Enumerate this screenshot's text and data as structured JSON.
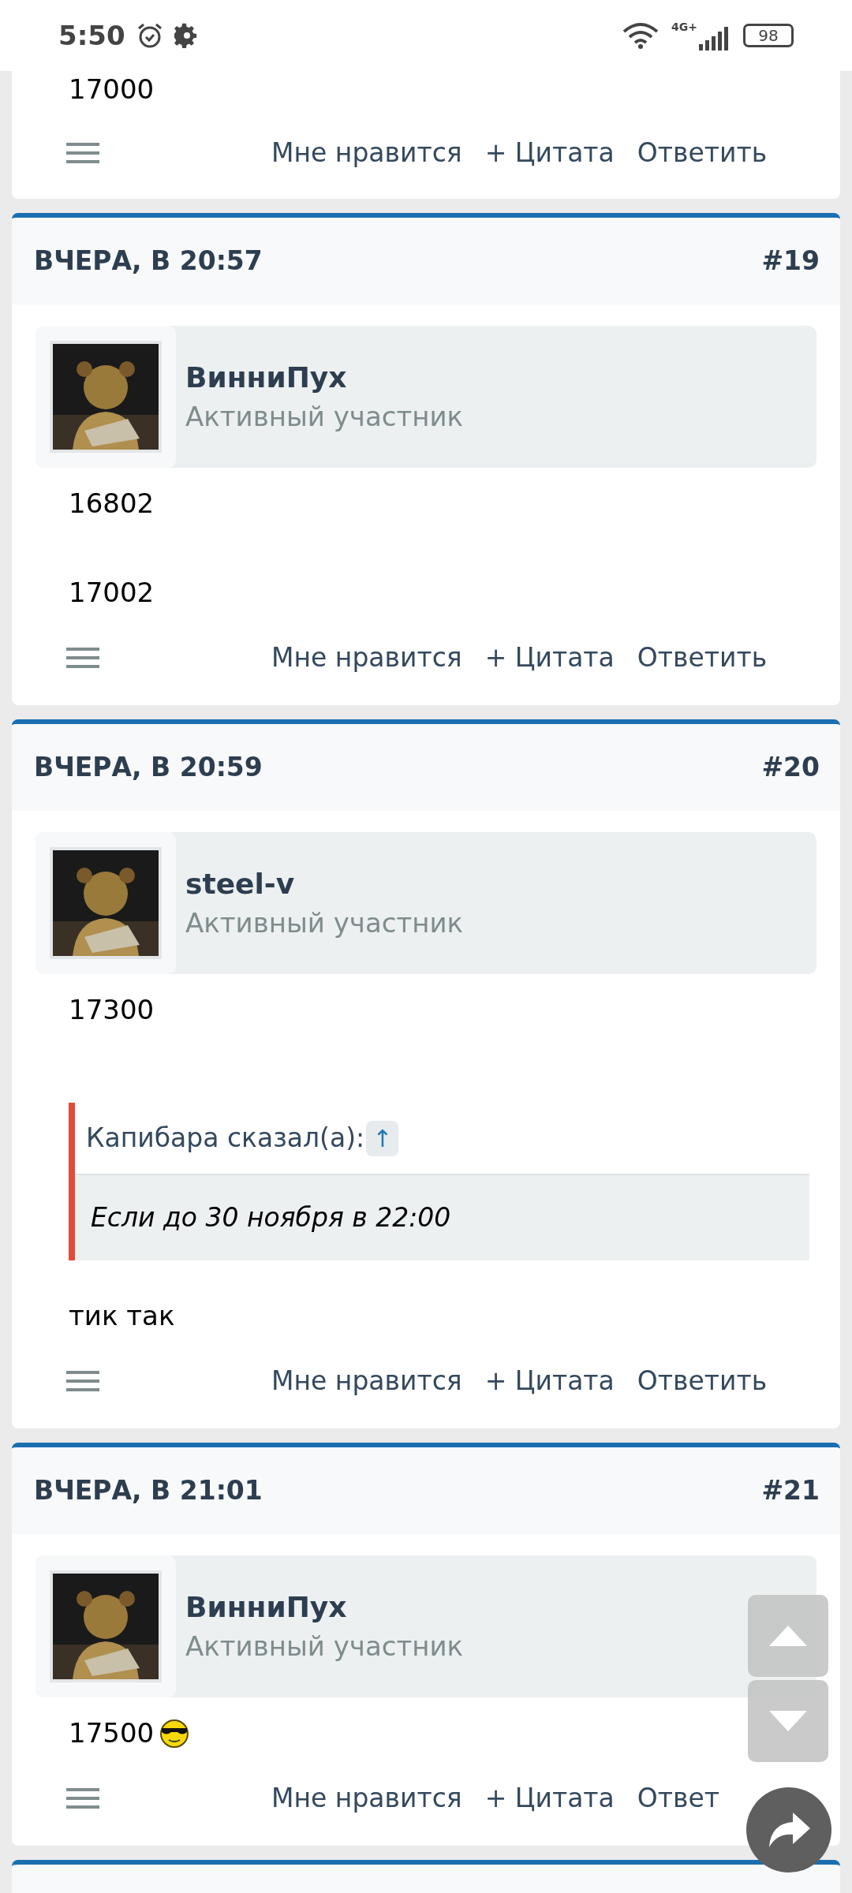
{
  "status_bar": {
    "time": "5:50",
    "network": "4G+",
    "battery": "98"
  },
  "top_post": {
    "content": [
      {
        "kind": "text",
        "text": "17000"
      }
    ],
    "actions": [
      "Мне нравится",
      "+ Цитата",
      "Ответить"
    ]
  },
  "posts": [
    {
      "date": "ВЧЕРА, В 20:57",
      "number": "#19",
      "author": {
        "name": "ВинниПух",
        "role": "Активный участник"
      },
      "content": [
        {
          "kind": "text",
          "text": "16802"
        },
        {
          "kind": "text",
          "text": "17002"
        }
      ],
      "actions": [
        "Мне нравится",
        "+ Цитата",
        "Ответить"
      ]
    },
    {
      "date": "ВЧЕРА, В 20:59",
      "number": "#20",
      "author": {
        "name": "steel-v",
        "role": "Активный участник"
      },
      "content": [
        {
          "kind": "text",
          "text": "17300"
        },
        {
          "kind": "quote",
          "author": "Капибара сказал(а):",
          "link": "↑",
          "text": "Если до 30 ноября в 22:00"
        },
        {
          "kind": "text",
          "text": "тик так"
        }
      ],
      "actions": [
        "Мне нравится",
        "+ Цитата",
        "Ответить"
      ]
    },
    {
      "date": "ВЧЕРА, В 21:01",
      "number": "#21",
      "author": {
        "name": "ВинниПух",
        "role": "Активный участник"
      },
      "content": [
        {
          "kind": "smiley_text",
          "text": "17500"
        }
      ],
      "actions": [
        "Мне нравится",
        "+ Цитата",
        "Ответ"
      ]
    }
  ]
}
